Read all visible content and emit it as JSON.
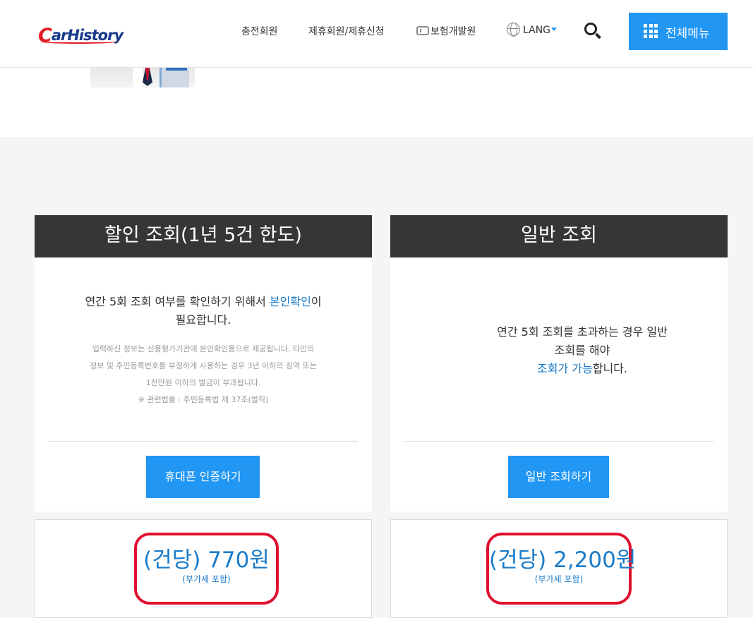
{
  "header": {
    "logo_text": "CarHistory",
    "nav": [
      {
        "label": "충전회원"
      },
      {
        "label": "제휴회원/제휴신청"
      },
      {
        "label": "보험개발원"
      },
      {
        "label": "LANG"
      }
    ],
    "menu_label": "전체메뉴",
    "icons": {
      "search": "search-icon",
      "menu": "grid-icon",
      "lang": "globe-icon",
      "kidi": "kidi-logo-icon"
    },
    "accent_color": "#2196f3"
  },
  "cards": [
    {
      "title": "할인 조회(1년 5건 한도)",
      "text_pre": "연간 5회 조회 여부를 확인하기 위해서 ",
      "text_link": "본인확인",
      "text_post_1": "이",
      "text_post_2": "필요합니다.",
      "notes": [
        "입력하신 정보는 신용평가기관에 본인확인용으로 제공됩니다. 타인의",
        "정보 및 주민등록번호를 부정하게 사용하는 경우 3년 이하의 징역 또는",
        "1천만원 이하의 벌금이 부과됩니다.",
        "※ 관련법률 : 주민등록법 제 37조(벌칙)"
      ],
      "button_label": "휴대폰 인증하기",
      "price": "(건당) 770원",
      "vat": "(부가세 포함)"
    },
    {
      "title": "일반 조회",
      "text_line1": "연간 5회 조회를 초과하는 경우 일반",
      "text_line2": "조회를 해야",
      "text_link": "조회가 가능",
      "text_post": "합니다.",
      "button_label": "일반 조회하기",
      "price": "(건당) 2,200원",
      "vat": "(부가세 포함)"
    }
  ],
  "colors": {
    "header_bar": "#363636",
    "link": "#1a7bc9",
    "highlight_border": "#e0102f"
  }
}
